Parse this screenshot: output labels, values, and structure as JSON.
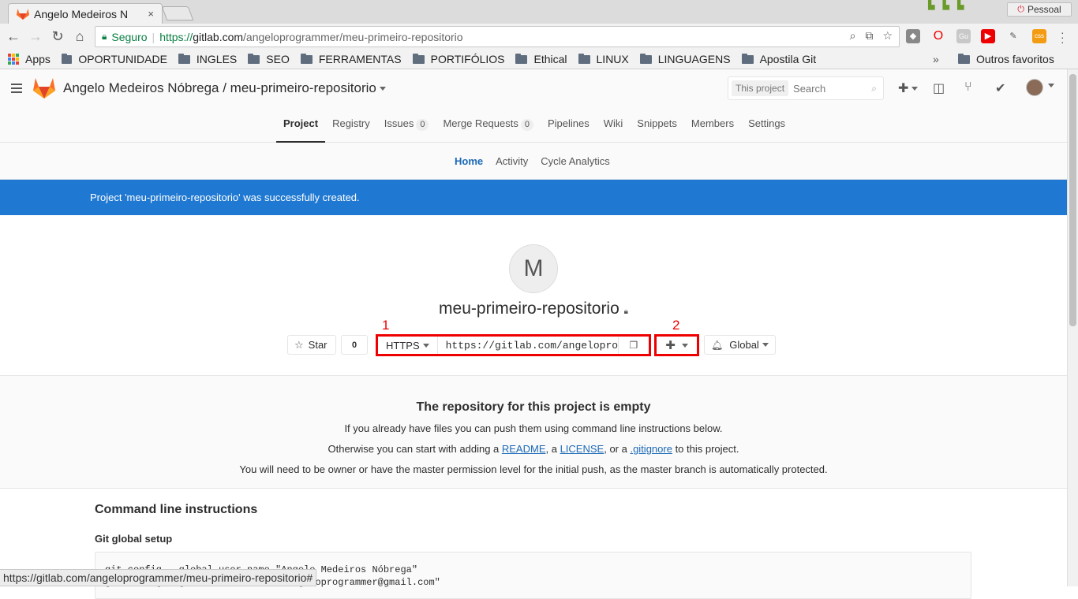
{
  "browser": {
    "tab_title": "Angelo Medeiros N",
    "tab_close": "×",
    "profile_label": "Pessoal",
    "security_label": "Seguro",
    "url_proto": "https://",
    "url_host": "gitlab.com",
    "url_path": "/angeloprogrammer/meu-primeiro-repositorio",
    "bookmarks": [
      {
        "label": "Apps",
        "type": "apps"
      },
      {
        "label": "OPORTUNIDADE",
        "type": "folder"
      },
      {
        "label": "INGLES",
        "type": "folder"
      },
      {
        "label": "SEO",
        "type": "folder"
      },
      {
        "label": "FERRAMENTAS",
        "type": "folder"
      },
      {
        "label": "PORTIFÓLIOS",
        "type": "folder"
      },
      {
        "label": "Ethical",
        "type": "folder"
      },
      {
        "label": "LINUX",
        "type": "folder"
      },
      {
        "label": "LINGUAGENS",
        "type": "folder"
      },
      {
        "label": "Apostila Git",
        "type": "folder"
      }
    ],
    "bookmarks_more": "»",
    "other_bookmarks": "Outros favoritos",
    "status_url": "https://gitlab.com/angeloprogrammer/meu-primeiro-repositorio#"
  },
  "header": {
    "title": "Angelo Medeiros Nóbrega / meu-primeiro-repositorio",
    "search_scope": "This project",
    "search_placeholder": "Search"
  },
  "nav": {
    "tabs": [
      {
        "label": "Project",
        "active": true
      },
      {
        "label": "Registry"
      },
      {
        "label": "Issues",
        "badge": "0"
      },
      {
        "label": "Merge Requests",
        "badge": "0"
      },
      {
        "label": "Pipelines"
      },
      {
        "label": "Wiki"
      },
      {
        "label": "Snippets"
      },
      {
        "label": "Members"
      },
      {
        "label": "Settings"
      }
    ],
    "subtabs": [
      "Home",
      "Activity",
      "Cycle Analytics"
    ]
  },
  "flash": "Project 'meu-primeiro-repositorio' was successfully created.",
  "project": {
    "avatar_letter": "M",
    "name": "meu-primeiro-repositorio",
    "star_label": "Star",
    "star_count": "0",
    "clone_protocol": "HTTPS",
    "clone_url": "https://gitlab.com/angeloprogrammer/meu-primeiro-repositorio.git",
    "notification_label": "Global",
    "marker_1": "1",
    "marker_2": "2"
  },
  "empty": {
    "title": "The repository for this project is empty",
    "line1": "If you already have files you can push them using command line instructions below.",
    "line2_pre": "Otherwise you can start with adding a ",
    "readme": "README",
    "comma": ", a ",
    "license": "LICENSE",
    "or": ", or a ",
    "gitignore": ".gitignore",
    "line2_post": " to this project.",
    "line3": "You will need to be owner or have the master permission level for the initial push, as the master branch is automatically protected."
  },
  "cli": {
    "title": "Command line instructions",
    "subtitle": "Git global setup",
    "code": "git config --global user.name \"Angelo Medeiros Nóbrega\"\ngit config --global user.email \"angeloprogrammer@gmail.com\""
  },
  "colors": {
    "accent_blue": "#1f78d1",
    "link_blue": "#1b69b6",
    "highlight_red": "#e00000",
    "gitlab_orange": "#fc6d26"
  }
}
